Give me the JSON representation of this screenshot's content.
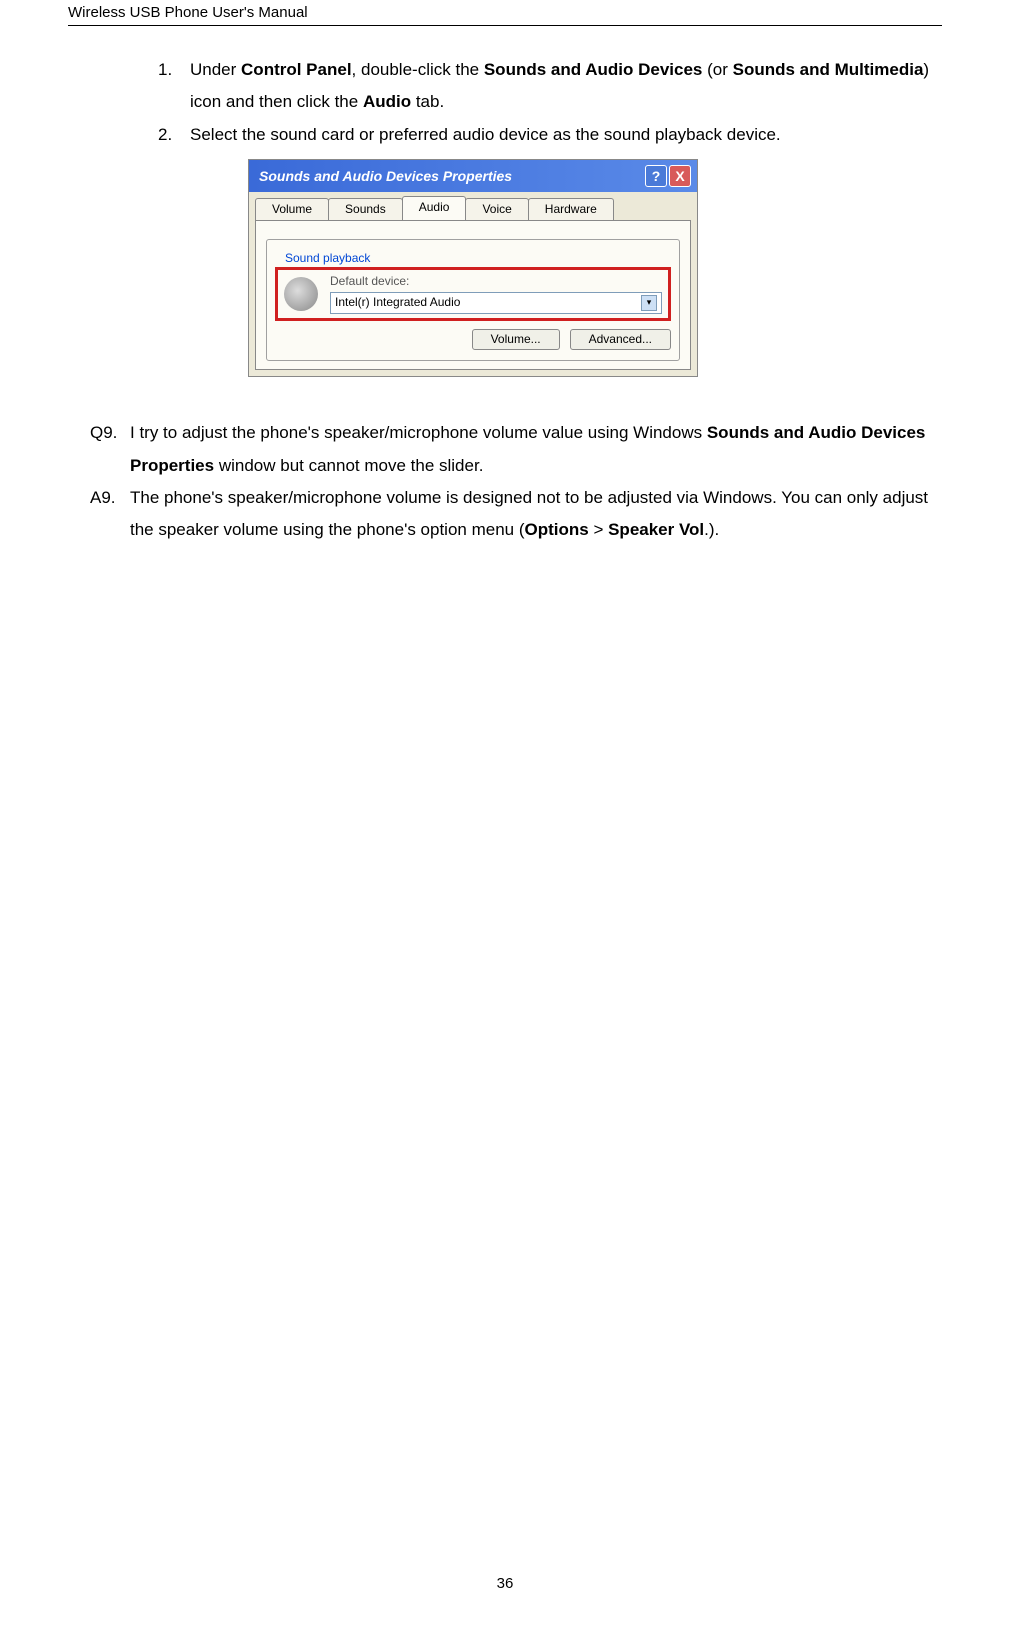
{
  "header": {
    "title": "Wireless USB Phone User's Manual"
  },
  "steps": [
    {
      "num": "1.",
      "parts": [
        "Under ",
        "Control Panel",
        ", double-click the ",
        "Sounds and Audio Devices",
        " (or ",
        "Sounds and Multimedia",
        ") icon and then click the ",
        "Audio",
        " tab."
      ],
      "bold": [
        1,
        3,
        5,
        7
      ]
    },
    {
      "num": "2.",
      "text": "Select the sound card or preferred audio device as the sound playback device."
    }
  ],
  "dialog": {
    "title": "Sounds and Audio Devices Properties",
    "tabs": [
      "Volume",
      "Sounds",
      "Audio",
      "Voice",
      "Hardware"
    ],
    "active_tab": 2,
    "fieldset_legend": "Sound playback",
    "default_label": "Default device:",
    "default_value": "Intel(r) Integrated Audio",
    "volume_btn": "Volume...",
    "advanced_btn": "Advanced...",
    "help_glyph": "?",
    "close_glyph": "X"
  },
  "qa": {
    "q_label": "Q9.",
    "q_parts": [
      "I try to adjust the phone's speaker/microphone volume value using Windows ",
      "Sounds and Audio Devices Properties",
      " window but cannot move the slider."
    ],
    "q_bold": [
      1
    ],
    "a_label": "A9.",
    "a_parts": [
      "The phone's speaker/microphone volume is designed not to be adjusted via Windows. You can only adjust the speaker volume using the phone's option menu (",
      "Options",
      " > ",
      "Speaker Vol",
      ".)."
    ],
    "a_bold": [
      1,
      3
    ]
  },
  "page_number": "36"
}
